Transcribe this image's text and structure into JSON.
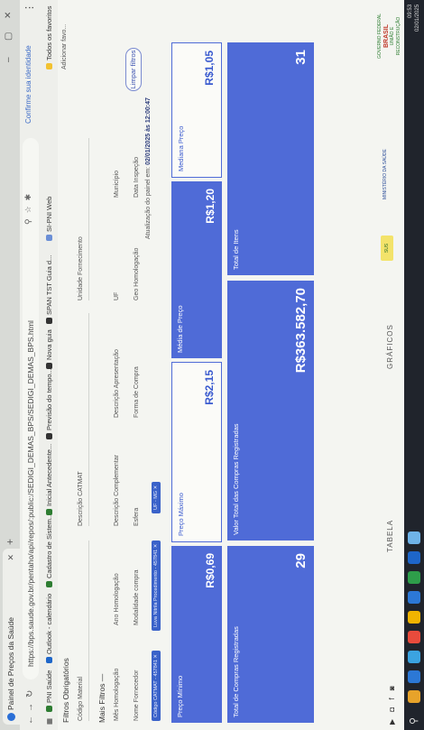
{
  "browser": {
    "tabs": [
      {
        "label": "Painel de Preços da Saúde"
      }
    ],
    "new_tab": "+",
    "minimize": "–",
    "maximize": "▢",
    "close": "✕",
    "url": "https://bps.saude.gov.br/pentaho/api/repos/:public:/SEDIGI_DEMAS_BPS/SEDIGI_DEMAS_BPS.html",
    "profile_label": "Confirme sua identidade",
    "bookmarks": [
      {
        "label": "PNI Saúde",
        "color": "#2e7d32"
      },
      {
        "label": "Outlook - calendário",
        "color": "#1e66c9"
      },
      {
        "label": "Cadastro de Sistem...",
        "color": "#2e7d32"
      },
      {
        "label": "Inicial Antecedente...",
        "color": "#2e7d32"
      },
      {
        "label": "Previsão do tempo...",
        "color": "#333333"
      },
      {
        "label": "Nova guia",
        "color": "#333333"
      },
      {
        "label": "SPAN TST Guia d...",
        "color": "#333333"
      },
      {
        "label": "SI-PNI Web",
        "color": "#6b8fd6"
      },
      {
        "label": "Todos os favoritos",
        "color": "#f2c230"
      }
    ],
    "other_label": "Adicionar favo..."
  },
  "filters": {
    "section_title": "Filtros Obrigatórios",
    "labels_row1": [
      "Código Material",
      "Descrição CATMAT",
      "Unidade Fornecimento"
    ],
    "more_title": "Mais Filtros —",
    "labels_row2": [
      "Mês Homologação",
      "Ano Homologação",
      "Descrição Complementar",
      "Descrição Apresentação",
      "UF",
      "Município"
    ],
    "labels_row3": [
      "Nome Fornecedor",
      "Modalidade compra",
      "Esfera",
      "Forma de Compra",
      "Geo Homologação",
      "Data Inspeção"
    ],
    "chips": [
      "Código CATMAT - 457841 ✕",
      "Luva Nitrila Procedimento - 457841 ✕",
      "UF - MG ✕"
    ],
    "clear_label": "Limpar filtros",
    "updated_prefix": "Atualização do painel em:",
    "updated_value": "02/01/2025 às 12:00:47"
  },
  "cards": {
    "min_price": {
      "title": "Preço Mínimo",
      "value": "R$0,69"
    },
    "max_price": {
      "title": "Preço Máximo",
      "value": "R$2,15"
    },
    "avg_price": {
      "title": "Média de Preço",
      "value": "R$1,20"
    },
    "median_price": {
      "title": "Mediana Preço",
      "value": "R$1,05"
    },
    "total_purchases": {
      "title": "Total de Compras Registradas",
      "value": "29"
    },
    "total_value": {
      "title": "Valor Total das Compras Registradas",
      "value": "R$363.582,70"
    },
    "total_items": {
      "title": "Total de Itens",
      "value": "31"
    }
  },
  "bottom_tabs": {
    "table": "TABELA",
    "charts": "GRÁFICOS"
  },
  "footer": {
    "social": "▶ ◘ f ◙",
    "sus_logo": "SUS",
    "ministry": "MINISTÉRIO DA SAÚDE",
    "gov_top": "GOVERNO FEDERAL",
    "gov_brand": "BRASIL",
    "gov_motto": "UNIÃO E RECONSTRUÇÃO"
  },
  "taskbar": {
    "time": "09:53",
    "date": "02/01/2025",
    "icon_colors": [
      "#e7a32a",
      "#2c78d6",
      "#3ba3e0",
      "#e94b3c",
      "#f0b400",
      "#2c78d6",
      "#2e9e4a",
      "#1e66c9",
      "#6fb3e8"
    ]
  }
}
